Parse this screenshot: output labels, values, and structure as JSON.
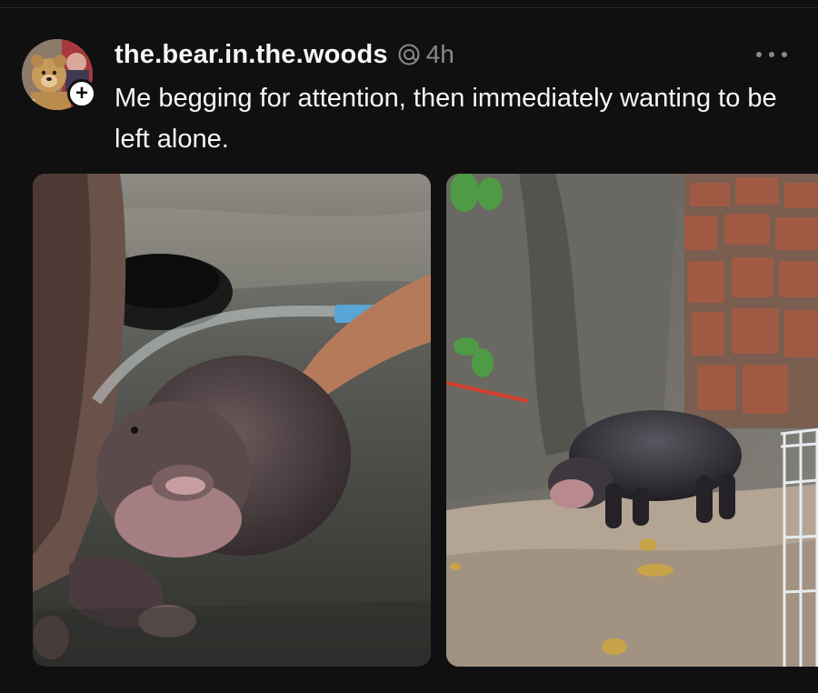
{
  "post": {
    "username": "the.bear.in.the.woods",
    "time": "4h",
    "caption": "Me begging for attention, then immediately wanting to be left alone.",
    "follow_symbol": "+",
    "icons": {
      "avatar": "bear-avatar",
      "verified": "threads-badge-icon",
      "more": "more-options-icon"
    },
    "media": [
      {
        "alt": "baby hippo being hosed with water"
      },
      {
        "alt": "baby hippo standing alone by wall"
      }
    ]
  },
  "colors": {
    "background": "#101010",
    "text_primary": "#f3f5f7",
    "text_secondary": "#8a8a8a"
  }
}
